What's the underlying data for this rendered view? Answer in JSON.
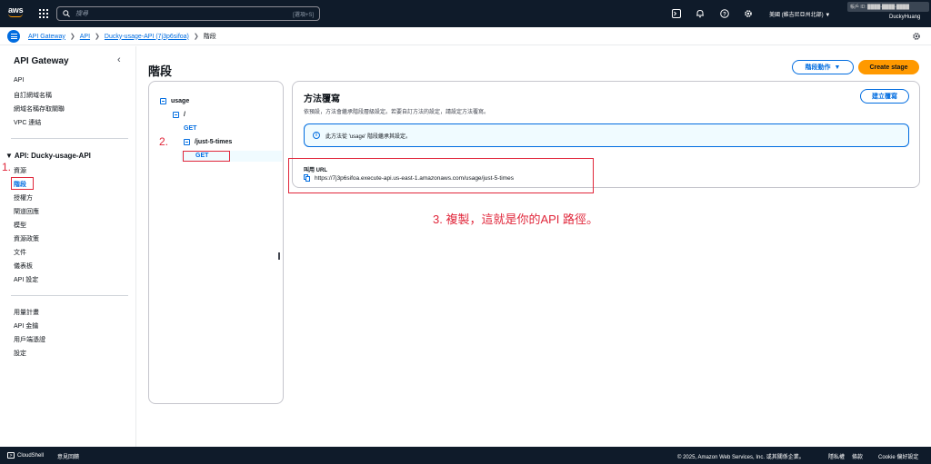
{
  "topnav": {
    "logo_text": "aws",
    "search_placeholder": "搜尋",
    "search_shortcut": "[選項+S]",
    "icons": [
      "cloudshell-icon",
      "bell-icon",
      "help-icon",
      "gear-icon"
    ],
    "region": "美國 (維吉尼亞州北部) ▼",
    "account": "帳戶 ID: ████-████-████",
    "username": "DuckyHuang"
  },
  "breadcrumb": {
    "items": [
      "API Gateway",
      "API",
      "Ducky-usage-API (7j3p6sifoa)"
    ],
    "current": "階段"
  },
  "sidebar": {
    "title": "API Gateway",
    "top_items": [
      "API",
      "自訂網域名稱",
      "網域名稱存取關聯",
      "VPC 連結"
    ],
    "section": "API: Ducky-usage-API",
    "section_items": [
      "資源",
      "階段",
      "授權方",
      "閘道回應",
      "模型",
      "資源政策",
      "文件",
      "儀表板",
      "API 設定"
    ],
    "active_index": 1,
    "bottom_items": [
      "用量計畫",
      "API 金鑰",
      "用戶端憑證",
      "設定"
    ]
  },
  "annotations": {
    "one": "1.",
    "two": "2.",
    "three": "3. 複製，這就是你的API 路徑。"
  },
  "main": {
    "title": "階段",
    "stage_actions": "階段動作",
    "create_stage": "Create stage"
  },
  "tree": {
    "root": "usage",
    "slash": "/",
    "get1": "GET",
    "child": "/just-5-times",
    "get2": "GET"
  },
  "method_panel": {
    "title": "方法覆寫",
    "description": "依預設，方法會繼承階段層級設定。若要自訂方法的設定，請設定方法覆寫。",
    "create_override": "建立覆寫",
    "info": "此方法從 'usage' 階段繼承其設定。",
    "url_label": "叫用 URL",
    "url": "https://7j3p6sifoa.execute-api.us-east-1.amazonaws.com/usage/just-5-times"
  },
  "footer": {
    "cloudshell": "CloudShell",
    "feedback": "意見回饋",
    "copyright": "© 2025, Amazon Web Services, Inc. 或其關係企業。",
    "privacy": "隱私權",
    "terms": "條款",
    "cookie": "Cookie 偏好設定"
  },
  "colors": {
    "nav_bg": "#0f1b2a",
    "link": "#006ce0",
    "accent": "#ff9900",
    "annotation": "#e0263a"
  }
}
